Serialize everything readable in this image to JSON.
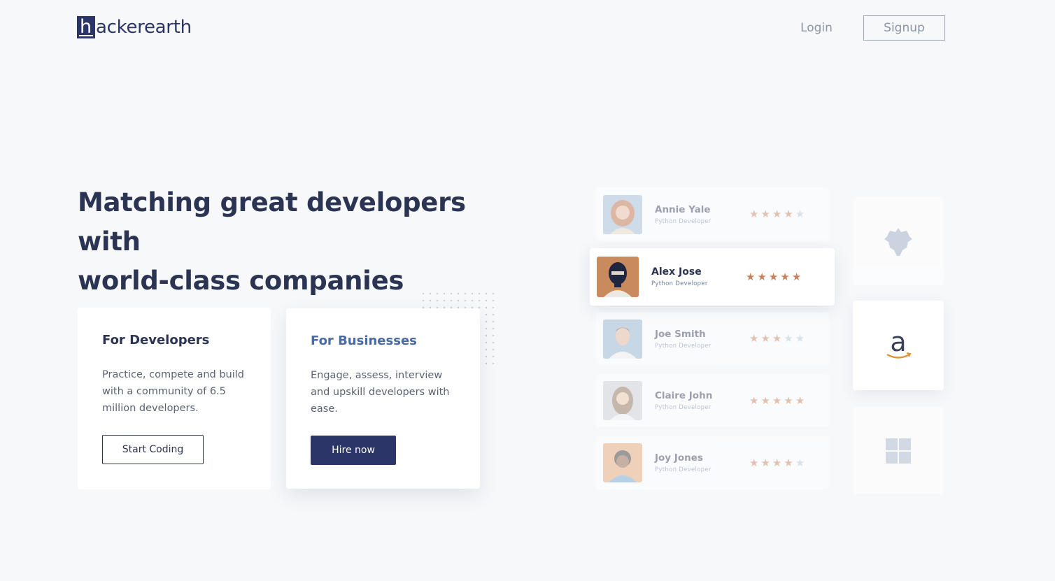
{
  "header": {
    "logo_mark": "h",
    "logo_text": "ackerearth",
    "login_label": "Login",
    "signup_label": "Signup"
  },
  "hero": {
    "title_line1": "Matching great developers with",
    "title_line2": "world-class companies"
  },
  "cards": {
    "developers": {
      "title": "For Developers",
      "description": "Practice, compete and build with a community of 6.5 million developers.",
      "button_label": "Start Coding"
    },
    "businesses": {
      "title": "For Businesses",
      "description": "Engage, assess, interview and upskill developers with ease.",
      "button_label": "Hire now"
    }
  },
  "profiles": [
    {
      "name": "Annie Yale",
      "role": "Python Developer",
      "rating": 4
    },
    {
      "name": "Alex Jose",
      "role": "Python Developer",
      "rating": 5
    },
    {
      "name": "Joe Smith",
      "role": "Python Developer",
      "rating": 3
    },
    {
      "name": "Claire John",
      "role": "Python Developer",
      "rating": 5
    },
    {
      "name": "Joy Jones",
      "role": "Python Developer",
      "rating": 4
    }
  ],
  "companies": [
    "eagle-logo-icon",
    "amazon-logo-icon",
    "windows-logo-icon"
  ],
  "colors": {
    "brand": "#2c3567",
    "star_on": "#c8815a",
    "star_off": "#b9c6d6",
    "background": "#f7f8fa"
  }
}
